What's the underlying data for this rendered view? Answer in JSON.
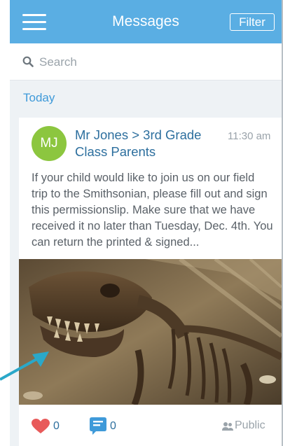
{
  "header": {
    "title": "Messages",
    "filter_label": "Filter",
    "menu_icon": "hamburger-menu-icon"
  },
  "search": {
    "placeholder": "Search",
    "icon": "search-icon"
  },
  "section": {
    "label": "Today"
  },
  "message": {
    "avatar_initials": "MJ",
    "avatar_color": "#8cc63f",
    "sender": "Mr Jones > 3rd Grade Class Parents",
    "time": "11:30 am",
    "body": "If your child would like to join us on our field trip to the Smithsonian, please fill out and sign this permissionslip. Make sure that we have received it no later than Tuesday, Dec. 4th. You can return the printed & signed...",
    "likes": "0",
    "comments": "0",
    "visibility": "Public"
  },
  "colors": {
    "header": "#5aaee3",
    "accent": "#3f9ad9",
    "like": "#e85a5a",
    "arrow": "#2aa8c9"
  }
}
